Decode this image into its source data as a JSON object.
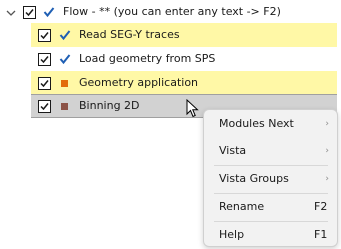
{
  "colors": {
    "highlight": "#fff8a6",
    "selected_row": "#d2d2d2",
    "check_blue": "#1f5fb4",
    "geometry_square": "#e36c0a",
    "binning_square": "#8c5246",
    "menu_bg": "#f2f2f2"
  },
  "tree": {
    "root": {
      "label": "Flow - **  (you can enter any text -> F2)",
      "expanded": true,
      "checked": true,
      "expander_icon": "chevron-down-icon",
      "status_icon": "blue-check-icon"
    },
    "items": [
      {
        "label": "Read SEG-Y traces",
        "checked": true,
        "status_icon": "blue-check-icon",
        "highlighted": true
      },
      {
        "label": "Load geometry from SPS",
        "checked": true,
        "status_icon": "blue-check-icon",
        "highlighted": false
      },
      {
        "label": "Geometry application",
        "checked": true,
        "status_icon": "orange-square-icon",
        "highlighted": true
      },
      {
        "label": "Binning 2D",
        "checked": true,
        "status_icon": "brown-square-icon",
        "selected": true
      }
    ]
  },
  "context_menu": {
    "items": [
      {
        "label": "Modules Next",
        "submenu_icon": "chevron-right-icon"
      },
      {
        "label": "Vista",
        "submenu_icon": "chevron-right-icon"
      },
      {
        "label": "Vista Groups",
        "submenu_icon": "chevron-right-icon"
      },
      {
        "label": "Rename",
        "shortcut": "F2"
      },
      {
        "label": "Help",
        "shortcut": "F1"
      }
    ]
  },
  "cursor_icon": "mouse-pointer-icon"
}
